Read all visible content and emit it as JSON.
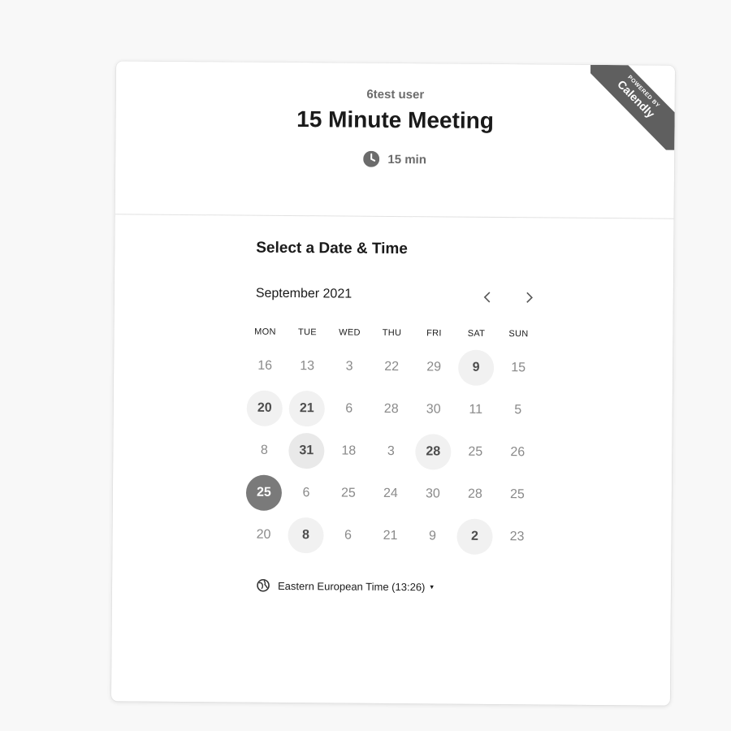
{
  "header": {
    "organizer": "6test user",
    "title": "15 Minute Meeting",
    "duration": "15 min",
    "duration_icon": "clock-icon"
  },
  "ribbon": {
    "powered_by": "POWERED BY",
    "brand": "Calendly",
    "color": "#5f5f5f"
  },
  "calendar": {
    "section_title": "Select a Date & Time",
    "month": "September 2021",
    "prev_icon": "chevron-left-icon",
    "next_icon": "chevron-right-icon",
    "weekdays": [
      "MON",
      "TUE",
      "WED",
      "THU",
      "FRI",
      "SAT",
      "SUN"
    ],
    "days": [
      {
        "label": "16",
        "state": "unavailable"
      },
      {
        "label": "13",
        "state": "unavailable"
      },
      {
        "label": "3",
        "state": "unavailable"
      },
      {
        "label": "22",
        "state": "unavailable"
      },
      {
        "label": "29",
        "state": "unavailable"
      },
      {
        "label": "9",
        "state": "available"
      },
      {
        "label": "15",
        "state": "unavailable"
      },
      {
        "label": "20",
        "state": "available"
      },
      {
        "label": "21",
        "state": "available"
      },
      {
        "label": "6",
        "state": "unavailable"
      },
      {
        "label": "28",
        "state": "unavailable"
      },
      {
        "label": "30",
        "state": "unavailable"
      },
      {
        "label": "11",
        "state": "unavailable"
      },
      {
        "label": "5",
        "state": "unavailable"
      },
      {
        "label": "8",
        "state": "unavailable"
      },
      {
        "label": "31",
        "state": "available-strong"
      },
      {
        "label": "18",
        "state": "unavailable"
      },
      {
        "label": "3",
        "state": "unavailable"
      },
      {
        "label": "28",
        "state": "available"
      },
      {
        "label": "25",
        "state": "unavailable"
      },
      {
        "label": "26",
        "state": "unavailable"
      },
      {
        "label": "25",
        "state": "selected"
      },
      {
        "label": "6",
        "state": "unavailable"
      },
      {
        "label": "25",
        "state": "unavailable"
      },
      {
        "label": "24",
        "state": "unavailable"
      },
      {
        "label": "30",
        "state": "unavailable"
      },
      {
        "label": "28",
        "state": "unavailable"
      },
      {
        "label": "25",
        "state": "unavailable"
      },
      {
        "label": "20",
        "state": "unavailable"
      },
      {
        "label": "8",
        "state": "available"
      },
      {
        "label": "6",
        "state": "unavailable"
      },
      {
        "label": "21",
        "state": "unavailable"
      },
      {
        "label": "9",
        "state": "unavailable"
      },
      {
        "label": "2",
        "state": "available"
      },
      {
        "label": "23",
        "state": "unavailable"
      }
    ]
  },
  "timezone": {
    "label": "Eastern European Time (13:26)",
    "icon": "globe-icon",
    "caret_icon": "caret-down-icon"
  },
  "colors": {
    "background": "#f8f8f8",
    "card": "#ffffff",
    "selected_day": "#7a7a7a",
    "available_day": "#f1f1f1"
  }
}
